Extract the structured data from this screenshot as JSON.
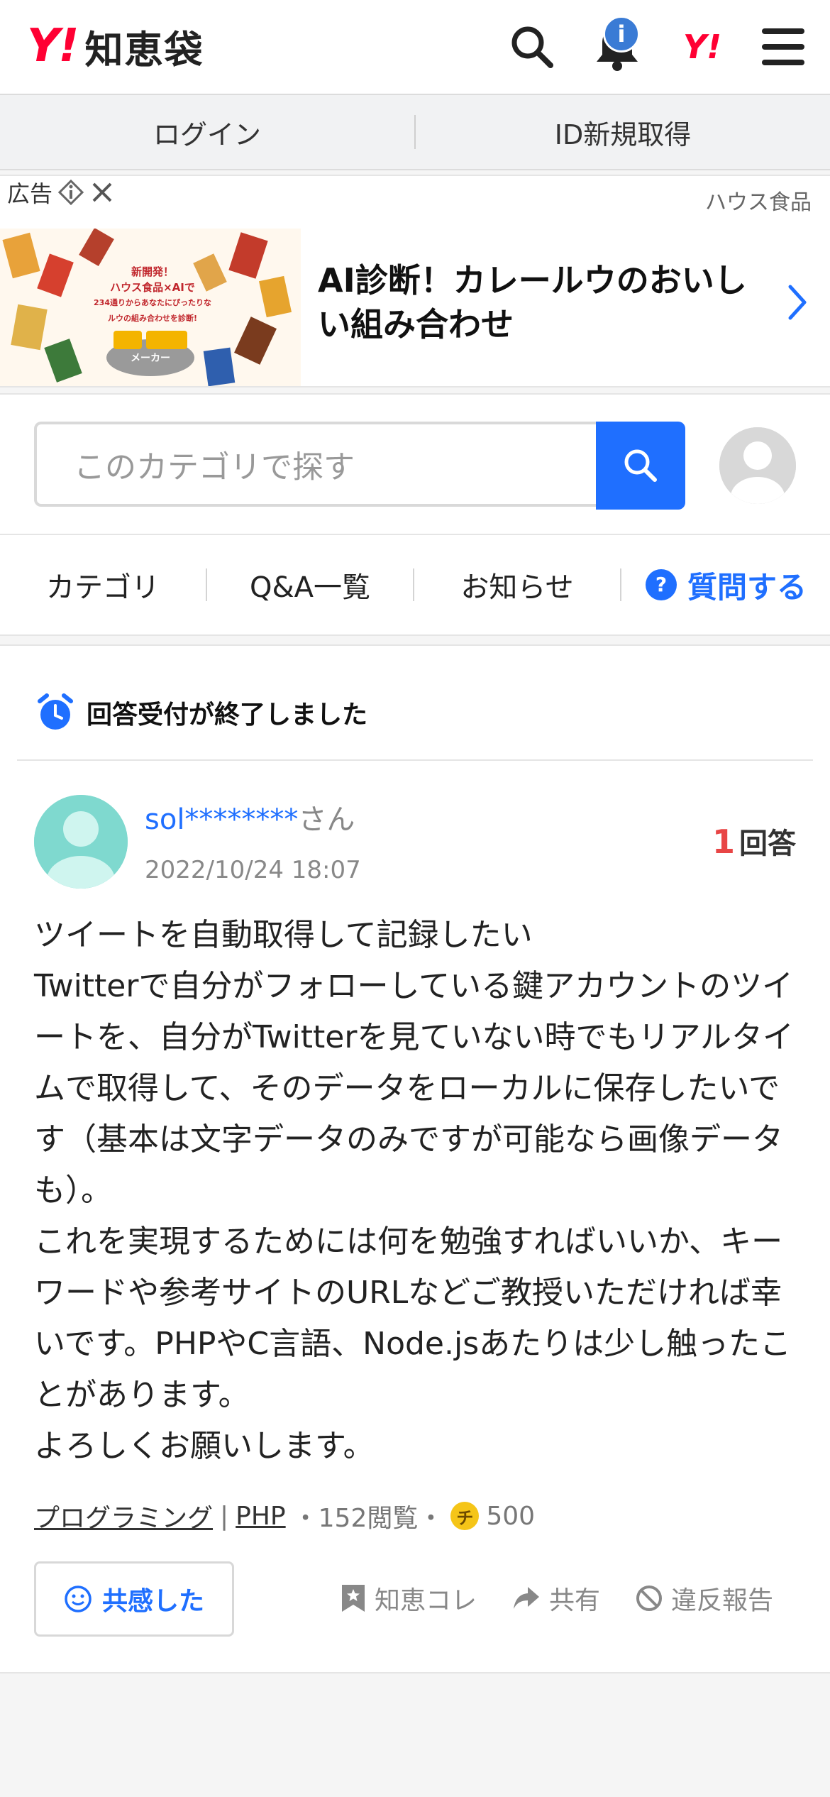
{
  "header": {
    "logo_mark": "Y!",
    "logo_text": "知恵袋",
    "notification_badge": "i",
    "yahoo_mark": "Y!"
  },
  "account_bar": {
    "login_label": "ログイン",
    "signup_label": "ID新規取得"
  },
  "ad": {
    "label": "広告",
    "sponsor": "ハウス食品",
    "title": "AI診断！カレールウのおいしい組み合わせ",
    "image_caption_1": "新開発！",
    "image_caption_2": "ハウス食品×AIで",
    "image_caption_3": "234通りからあなたにぴったりな",
    "image_caption_4": "ルウの組み合わせを診断!",
    "image_badge": "メーカー"
  },
  "search": {
    "placeholder": "このカテゴリで探す"
  },
  "nav": {
    "tabs": [
      "カテゴリ",
      "Q&A一覧",
      "お知らせ"
    ],
    "ask_label": "質問する"
  },
  "question": {
    "status": "回答受付が終了しました",
    "user_name": "sol********",
    "user_suffix": "さん",
    "date": "2022/10/24 18:07",
    "answer_count": "1",
    "answer_label": "回答",
    "body": "ツイートを自動取得して記録したい\nTwitterで自分がフォローしている鍵アカウントのツイートを、自分がTwitterを見ていない時でもリアルタイムで取得して、そのデータをローカルに保存したいです（基本は文字データのみですが可能なら画像データも）。\nこれを実現するためには何を勉強すればいいか、キーワードや参考サイトのURLなどご教授いただければ幸いです。PHPやC言語、Node.jsあたりは少し触ったことがあります。\nよろしくお願いします。",
    "category_1": "プログラミング",
    "separator": "|",
    "category_2": "PHP",
    "views": "・152閲覧・",
    "coin_label": "チ",
    "coins": "500",
    "empathy_label": "共感した",
    "bookmark_label": "知恵コレ",
    "share_label": "共有",
    "report_label": "違反報告"
  },
  "colors": {
    "accent": "#1f6fff",
    "brand_red": "#ff0033",
    "answer_count": "#e84545"
  }
}
